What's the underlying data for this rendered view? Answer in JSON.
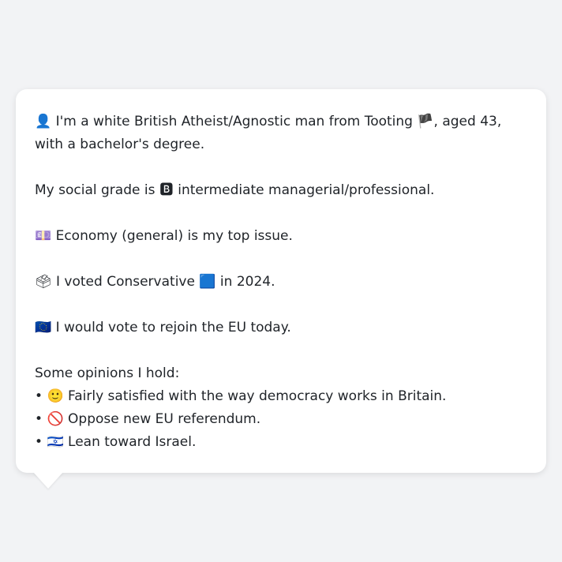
{
  "intro": {
    "emoji": "👤",
    "before_flag": "I'm a white British Atheist/Agnostic man from Tooting",
    "flag": "🏴",
    "after_flag": ", aged 43, with a bachelor's degree."
  },
  "social_grade": {
    "before": "My social grade is",
    "badge": "🅱",
    "after": "intermediate managerial/professional."
  },
  "top_issue": {
    "emoji": "💷",
    "text": "Economy (general) is my top issue."
  },
  "vote": {
    "emoji": "🗳",
    "before": "I voted Conservative",
    "party_emoji": "🟦",
    "after": "in 2024."
  },
  "eu": {
    "emoji": "🇪🇺",
    "text": "I would vote to rejoin the EU today."
  },
  "opinions": {
    "heading": "Some opinions I hold:",
    "items": [
      {
        "bullet": "•",
        "emoji": "🙂",
        "text": "Fairly satisfied with the way democracy works in Britain."
      },
      {
        "bullet": "•",
        "emoji": "🚫",
        "text": "Oppose new EU referendum."
      },
      {
        "bullet": "•",
        "emoji": "🇮🇱",
        "text": "Lean toward Israel."
      }
    ]
  }
}
